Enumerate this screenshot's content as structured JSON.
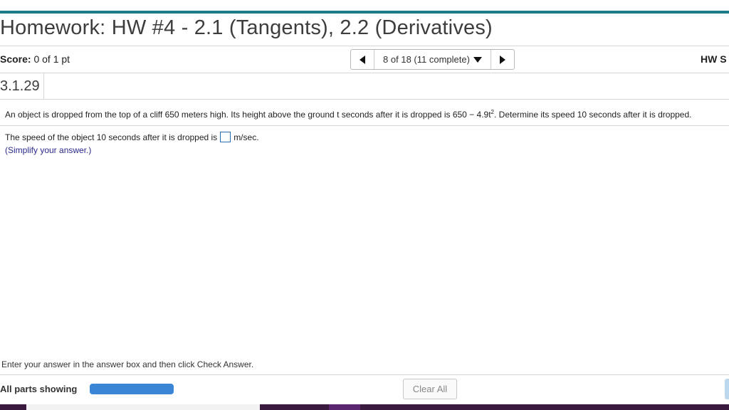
{
  "header": {
    "title": "Homework: HW #4 - 2.1 (Tangents), 2.2 (Derivatives)"
  },
  "score_bar": {
    "score_label": "Score:",
    "score_value": "0 of 1 pt",
    "nav_text": "8 of 18 (11 complete)",
    "hw_score_label": "HW S"
  },
  "question": {
    "number": "3.1.29",
    "prompt_part1": "An object is dropped from the top of a cliff 650 meters high. Its height above the ground t seconds after it is dropped is 650 − 4.9t",
    "prompt_exponent": "2",
    "prompt_part2": ". Determine its speed 10 seconds after it is dropped.",
    "answer_prefix": "The speed of the object 10 seconds after it is dropped is",
    "answer_unit": "m/sec.",
    "answer_value": "",
    "hint": "(Simplify your answer.)"
  },
  "footer": {
    "instruction": "Enter your answer in the answer box and then click Check Answer.",
    "parts_label": "All parts showing",
    "clear_label": "Clear All",
    "progress_fraction": 1.0
  },
  "colors": {
    "accent_bar": "#1b7a8c",
    "progress": "#3a86d4",
    "hint_text": "#2a2a8c",
    "answer_box_border": "#2b6cb0"
  },
  "icons": [
    "chevron-left-icon",
    "chevron-down-icon",
    "chevron-right-icon"
  ]
}
